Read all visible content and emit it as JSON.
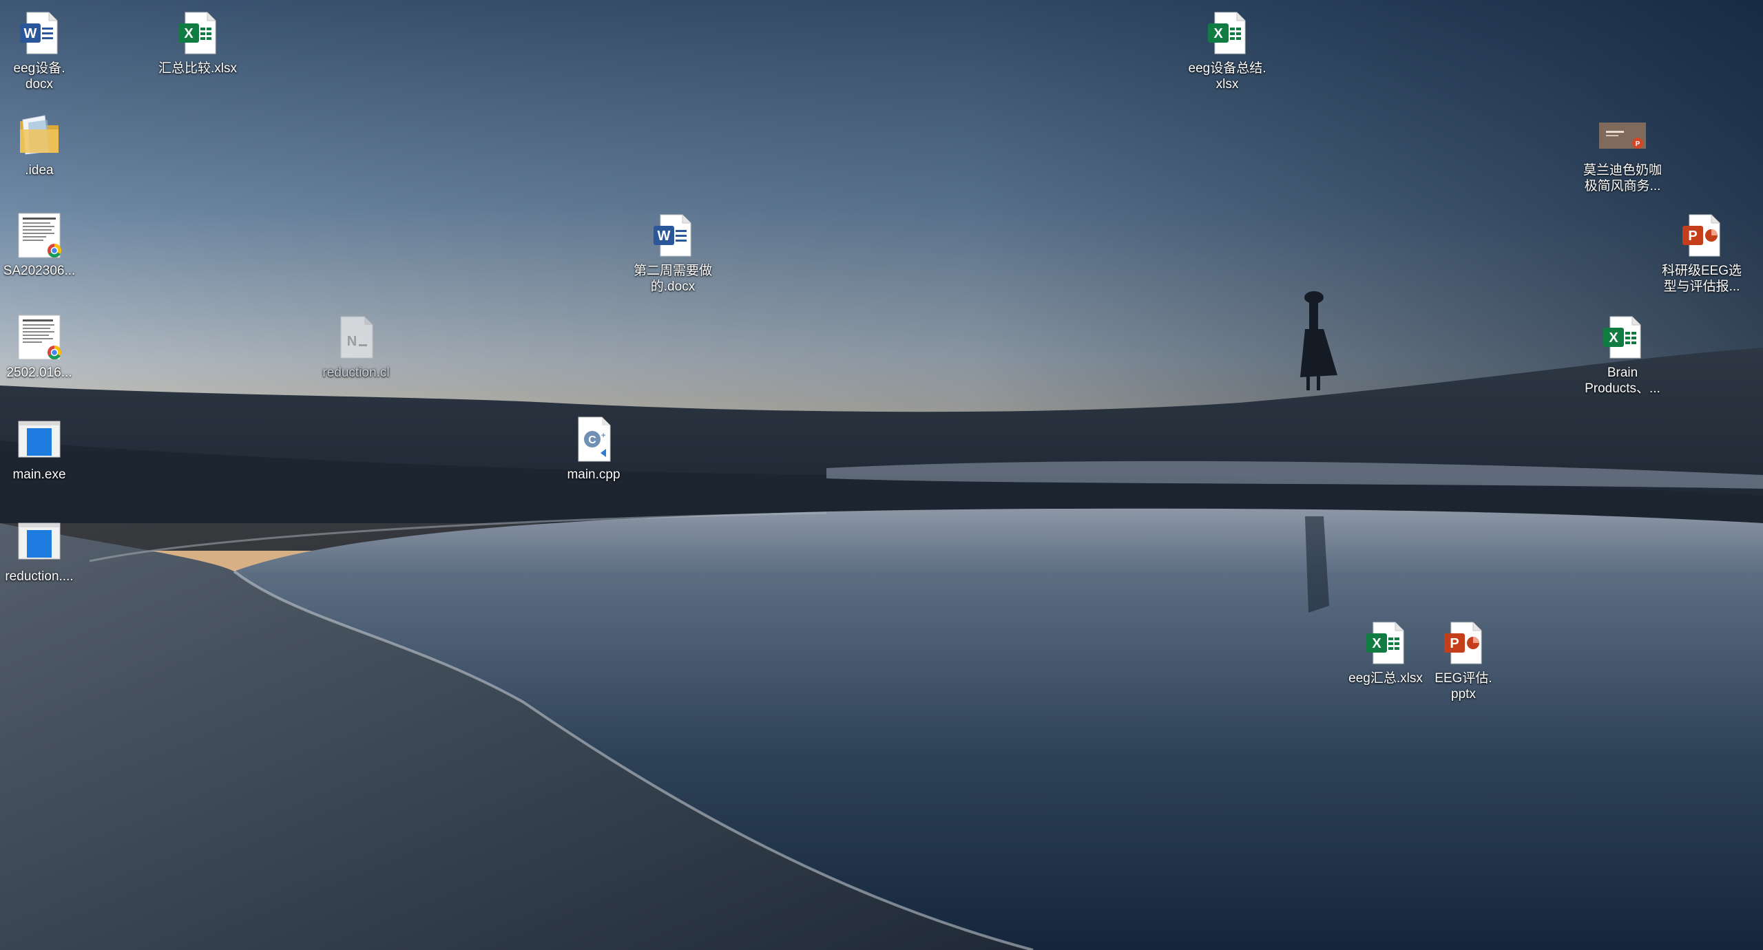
{
  "desktop": {
    "icons": [
      {
        "id": "eeg-docx",
        "label": "eeg设备.\ndocx",
        "icon": "word-doc-icon"
      },
      {
        "id": "huizong-xlsx",
        "label": "汇总比较.xlsx",
        "icon": "excel-sheet-icon"
      },
      {
        "id": "eeg-summary-xlsx",
        "label": "eeg设备总结.\nxlsx",
        "icon": "excel-sheet-icon"
      },
      {
        "id": "idea-folder",
        "label": ".idea",
        "icon": "folder-icon"
      },
      {
        "id": "morandi-ppt",
        "label": "莫兰迪色奶咖\n极简风商务...",
        "icon": "presentation-thumbnail-icon"
      },
      {
        "id": "sa-pdf",
        "label": "SA202306...",
        "icon": "pdf-chrome-icon"
      },
      {
        "id": "second-week-docx",
        "label": "第二周需要做\n的.docx",
        "icon": "word-doc-icon"
      },
      {
        "id": "research-eeg-pptx",
        "label": "科研级EEG选\n型与评估报...",
        "icon": "powerpoint-icon"
      },
      {
        "id": "pdf-2502",
        "label": "2502.016...",
        "icon": "pdf-chrome-icon"
      },
      {
        "id": "reduction-cl",
        "label": "reduction.cl",
        "icon": "generic-file-icon"
      },
      {
        "id": "brain-products-xlsx",
        "label": "Brain\nProducts、...",
        "icon": "excel-sheet-icon"
      },
      {
        "id": "main-exe",
        "label": "main.exe",
        "icon": "exe-window-icon"
      },
      {
        "id": "main-cpp",
        "label": "main.cpp",
        "icon": "cpp-source-icon"
      },
      {
        "id": "reduction-exe",
        "label": "reduction....",
        "icon": "exe-window-icon"
      },
      {
        "id": "eeg-huizong-xlsx",
        "label": "eeg汇总.xlsx",
        "icon": "excel-sheet-icon"
      },
      {
        "id": "eeg-eval-pptx",
        "label": "EEG评估.\npptx",
        "icon": "powerpoint-icon"
      }
    ]
  },
  "colors": {
    "word": "#2b579a",
    "excel": "#107c41",
    "powerpoint": "#c43e1c",
    "folder": "#e8c15a",
    "sky_top": "#3e5876",
    "horizon": "#e0c39a",
    "water": "#3a4f66"
  }
}
